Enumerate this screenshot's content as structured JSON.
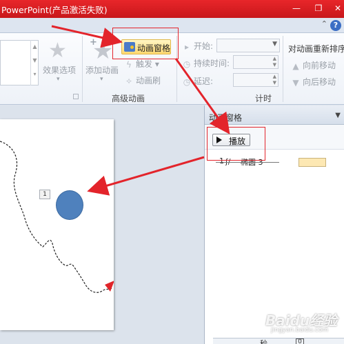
{
  "titlebar": {
    "title": "PowerPoint(产品激活失败)"
  },
  "ribbon": {
    "effect_options_label": "效果选项",
    "add_animation_label": "添加动画",
    "animation_pane_label": "动画窗格",
    "trigger_label": "触发",
    "animation_painter_label": "动画刷",
    "advanced_group_label": "高级动画",
    "start_label": "开始:",
    "duration_label": "持续时间:",
    "delay_label": "延迟:",
    "timing_group_label": "计时",
    "reorder_title": "对动画重新排序",
    "move_earlier_label": "向前移动",
    "move_later_label": "向后移动"
  },
  "slide": {
    "order_tag": "1"
  },
  "pane": {
    "title": "动画窗格",
    "play_label": "播放",
    "items": [
      {
        "index": "1",
        "name": "椭圆 3"
      }
    ],
    "timeline_unit": "秒",
    "timeline_start": "0"
  },
  "watermark": {
    "text": "Baidu经验",
    "sub": "jingyan.baidu.com"
  },
  "colors": {
    "title_bar": "#d31b1f",
    "annotation": "#e3242b",
    "oval_fill": "#4f81bd",
    "highlight": "#ffd870"
  }
}
